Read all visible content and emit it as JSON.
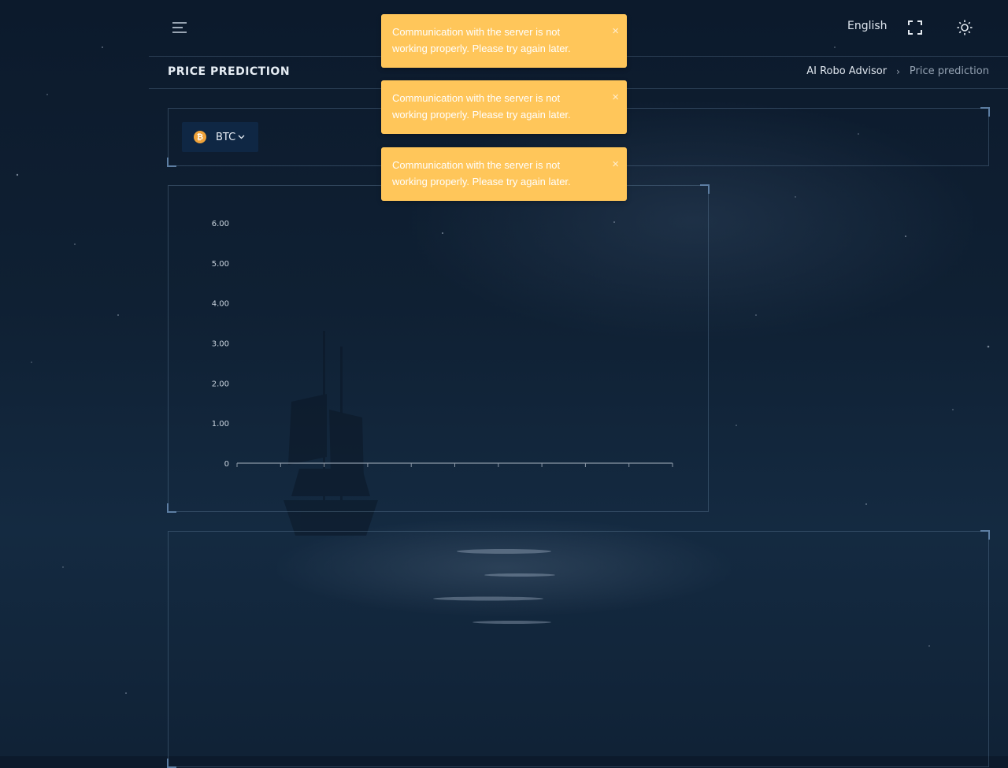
{
  "header": {
    "menu_icon": "hamburger-menu-icon",
    "language": "English",
    "fullscreen_icon": "fullscreen-icon",
    "theme_icon": "sun-icon"
  },
  "subheader": {
    "title": "PRICE PREDICTION",
    "breadcrumbs": [
      "AI Robo Advisor",
      "Price prediction"
    ]
  },
  "coin_selector": {
    "icon": "bitcoin-icon",
    "icon_glyph": "₿",
    "selected": "BTC"
  },
  "toasts": [
    {
      "message": "Communication with the server is not working properly. Please try again later.",
      "close": "×"
    },
    {
      "message": "Communication with the server is not working properly. Please try again later.",
      "close": "×"
    },
    {
      "message": "Communication with the server is not working properly. Please try again later.",
      "close": "×"
    }
  ],
  "colors": {
    "toast_bg": "#ffc65a",
    "panel_border": "#5d7ea3",
    "coin_accent": "#f0a33a"
  },
  "chart_data": {
    "type": "line",
    "yticks": [
      "6.00",
      "5.00",
      "4.00",
      "3.00",
      "2.00",
      "1.00",
      "0"
    ],
    "ylim": [
      0,
      6
    ],
    "x_tick_count": 10,
    "series": [],
    "grid": false
  }
}
